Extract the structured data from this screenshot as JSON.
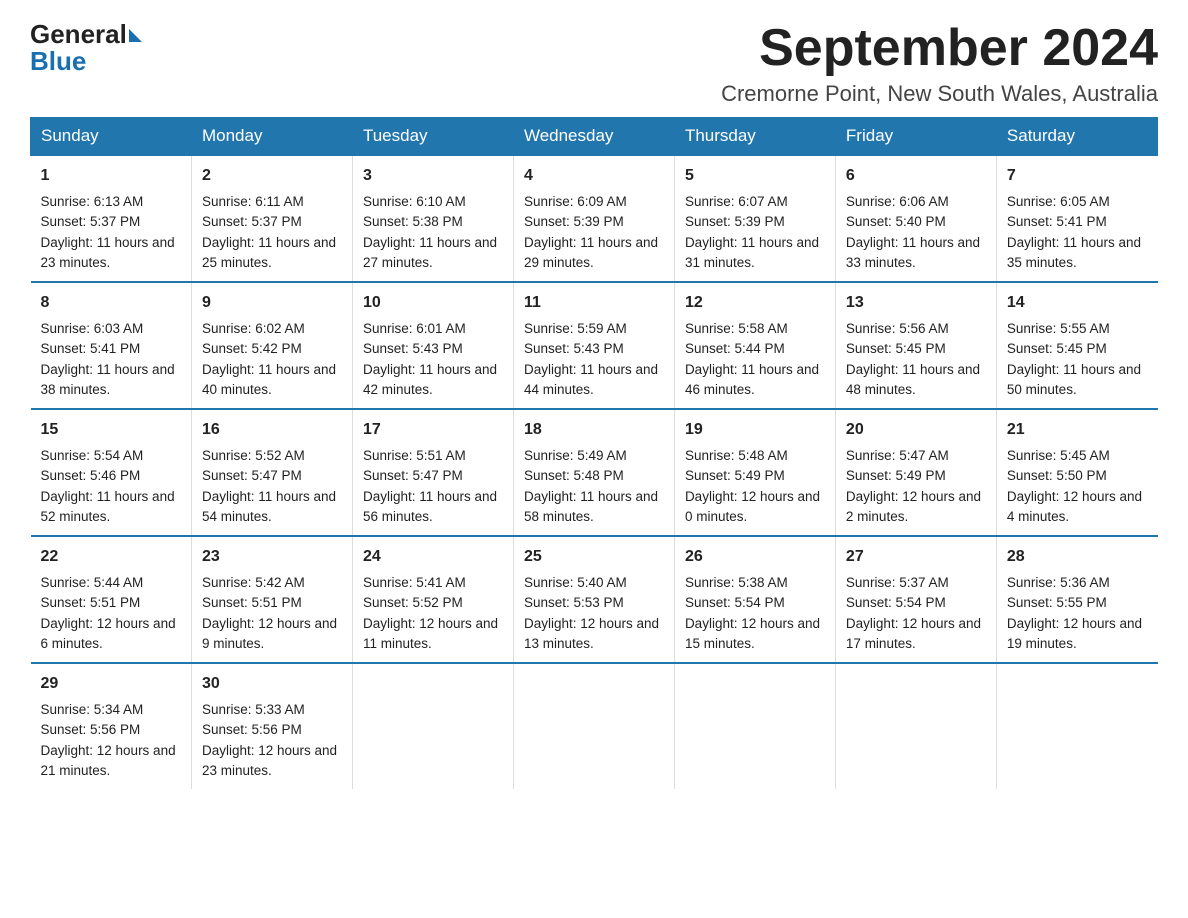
{
  "header": {
    "logo_text_general": "General",
    "logo_text_blue": "Blue",
    "month_title": "September 2024",
    "location": "Cremorne Point, New South Wales, Australia"
  },
  "days_of_week": [
    "Sunday",
    "Monday",
    "Tuesday",
    "Wednesday",
    "Thursday",
    "Friday",
    "Saturday"
  ],
  "weeks": [
    [
      {
        "day": "1",
        "sunrise": "6:13 AM",
        "sunset": "5:37 PM",
        "daylight": "11 hours and 23 minutes."
      },
      {
        "day": "2",
        "sunrise": "6:11 AM",
        "sunset": "5:37 PM",
        "daylight": "11 hours and 25 minutes."
      },
      {
        "day": "3",
        "sunrise": "6:10 AM",
        "sunset": "5:38 PM",
        "daylight": "11 hours and 27 minutes."
      },
      {
        "day": "4",
        "sunrise": "6:09 AM",
        "sunset": "5:39 PM",
        "daylight": "11 hours and 29 minutes."
      },
      {
        "day": "5",
        "sunrise": "6:07 AM",
        "sunset": "5:39 PM",
        "daylight": "11 hours and 31 minutes."
      },
      {
        "day": "6",
        "sunrise": "6:06 AM",
        "sunset": "5:40 PM",
        "daylight": "11 hours and 33 minutes."
      },
      {
        "day": "7",
        "sunrise": "6:05 AM",
        "sunset": "5:41 PM",
        "daylight": "11 hours and 35 minutes."
      }
    ],
    [
      {
        "day": "8",
        "sunrise": "6:03 AM",
        "sunset": "5:41 PM",
        "daylight": "11 hours and 38 minutes."
      },
      {
        "day": "9",
        "sunrise": "6:02 AM",
        "sunset": "5:42 PM",
        "daylight": "11 hours and 40 minutes."
      },
      {
        "day": "10",
        "sunrise": "6:01 AM",
        "sunset": "5:43 PM",
        "daylight": "11 hours and 42 minutes."
      },
      {
        "day": "11",
        "sunrise": "5:59 AM",
        "sunset": "5:43 PM",
        "daylight": "11 hours and 44 minutes."
      },
      {
        "day": "12",
        "sunrise": "5:58 AM",
        "sunset": "5:44 PM",
        "daylight": "11 hours and 46 minutes."
      },
      {
        "day": "13",
        "sunrise": "5:56 AM",
        "sunset": "5:45 PM",
        "daylight": "11 hours and 48 minutes."
      },
      {
        "day": "14",
        "sunrise": "5:55 AM",
        "sunset": "5:45 PM",
        "daylight": "11 hours and 50 minutes."
      }
    ],
    [
      {
        "day": "15",
        "sunrise": "5:54 AM",
        "sunset": "5:46 PM",
        "daylight": "11 hours and 52 minutes."
      },
      {
        "day": "16",
        "sunrise": "5:52 AM",
        "sunset": "5:47 PM",
        "daylight": "11 hours and 54 minutes."
      },
      {
        "day": "17",
        "sunrise": "5:51 AM",
        "sunset": "5:47 PM",
        "daylight": "11 hours and 56 minutes."
      },
      {
        "day": "18",
        "sunrise": "5:49 AM",
        "sunset": "5:48 PM",
        "daylight": "11 hours and 58 minutes."
      },
      {
        "day": "19",
        "sunrise": "5:48 AM",
        "sunset": "5:49 PM",
        "daylight": "12 hours and 0 minutes."
      },
      {
        "day": "20",
        "sunrise": "5:47 AM",
        "sunset": "5:49 PM",
        "daylight": "12 hours and 2 minutes."
      },
      {
        "day": "21",
        "sunrise": "5:45 AM",
        "sunset": "5:50 PM",
        "daylight": "12 hours and 4 minutes."
      }
    ],
    [
      {
        "day": "22",
        "sunrise": "5:44 AM",
        "sunset": "5:51 PM",
        "daylight": "12 hours and 6 minutes."
      },
      {
        "day": "23",
        "sunrise": "5:42 AM",
        "sunset": "5:51 PM",
        "daylight": "12 hours and 9 minutes."
      },
      {
        "day": "24",
        "sunrise": "5:41 AM",
        "sunset": "5:52 PM",
        "daylight": "12 hours and 11 minutes."
      },
      {
        "day": "25",
        "sunrise": "5:40 AM",
        "sunset": "5:53 PM",
        "daylight": "12 hours and 13 minutes."
      },
      {
        "day": "26",
        "sunrise": "5:38 AM",
        "sunset": "5:54 PM",
        "daylight": "12 hours and 15 minutes."
      },
      {
        "day": "27",
        "sunrise": "5:37 AM",
        "sunset": "5:54 PM",
        "daylight": "12 hours and 17 minutes."
      },
      {
        "day": "28",
        "sunrise": "5:36 AM",
        "sunset": "5:55 PM",
        "daylight": "12 hours and 19 minutes."
      }
    ],
    [
      {
        "day": "29",
        "sunrise": "5:34 AM",
        "sunset": "5:56 PM",
        "daylight": "12 hours and 21 minutes."
      },
      {
        "day": "30",
        "sunrise": "5:33 AM",
        "sunset": "5:56 PM",
        "daylight": "12 hours and 23 minutes."
      },
      null,
      null,
      null,
      null,
      null
    ]
  ],
  "labels": {
    "sunrise": "Sunrise:",
    "sunset": "Sunset:",
    "daylight": "Daylight:"
  }
}
